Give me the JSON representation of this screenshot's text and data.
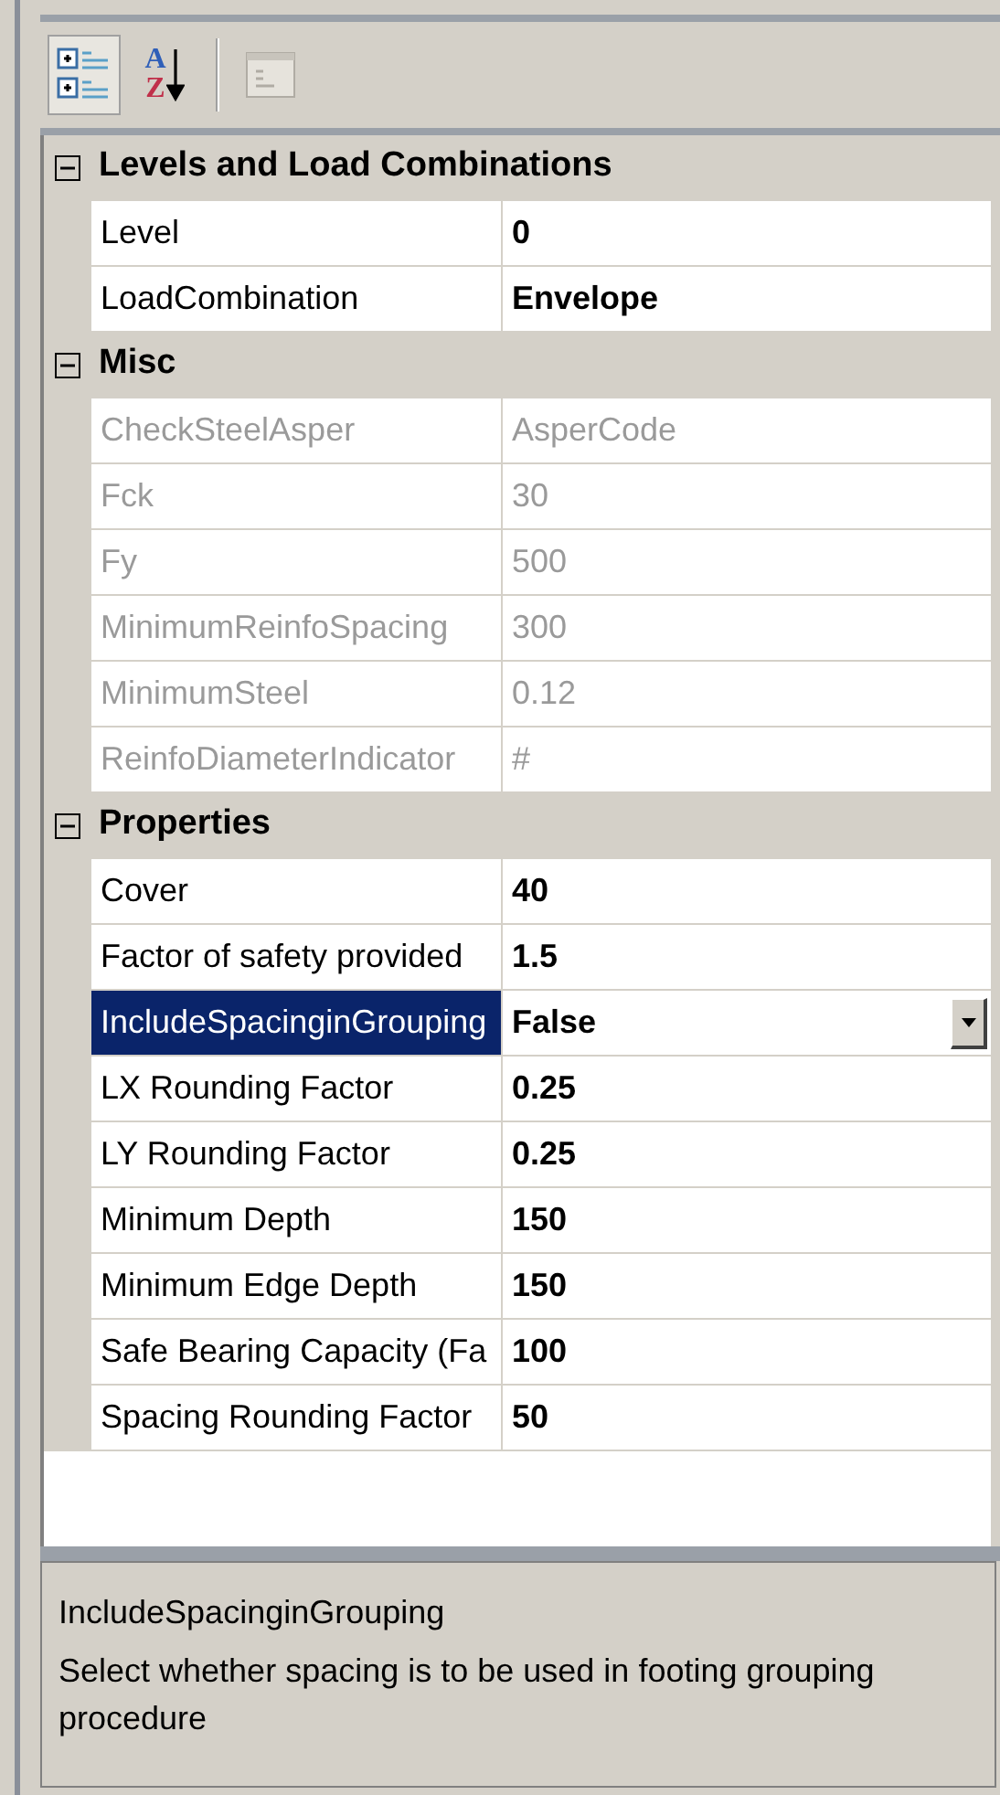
{
  "toolbar": [
    {
      "kind": "categorized",
      "selected": true
    },
    {
      "kind": "alphabetical",
      "selected": false,
      "glyphs": [
        "A",
        "Z"
      ]
    },
    {
      "kind": "pages",
      "selected": false,
      "disabled": true
    }
  ],
  "categories": [
    {
      "title": "Levels and Load Combinations",
      "expanded": true,
      "rows": [
        {
          "name": "Level",
          "value": "0",
          "disabled": false,
          "selected": false
        },
        {
          "name": "LoadCombination",
          "value": "Envelope",
          "disabled": false,
          "selected": false
        }
      ]
    },
    {
      "title": "Misc",
      "expanded": true,
      "rows": [
        {
          "name": "CheckSteelAsper",
          "value": "AsperCode",
          "disabled": true,
          "selected": false
        },
        {
          "name": "Fck",
          "value": "30",
          "disabled": true,
          "selected": false
        },
        {
          "name": "Fy",
          "value": "500",
          "disabled": true,
          "selected": false
        },
        {
          "name": "MinimumReinfoSpacing",
          "value": "300",
          "disabled": true,
          "selected": false
        },
        {
          "name": "MinimumSteel",
          "value": "0.12",
          "disabled": true,
          "selected": false
        },
        {
          "name": "ReinfoDiameterIndicator",
          "value": "#",
          "disabled": true,
          "selected": false
        }
      ]
    },
    {
      "title": "Properties",
      "expanded": true,
      "rows": [
        {
          "name": "Cover",
          "value": "40",
          "disabled": false,
          "selected": false
        },
        {
          "name": "Factor of safety provided",
          "value": "1.5",
          "disabled": false,
          "selected": false
        },
        {
          "name": "IncludeSpacinginGrouping",
          "value": "False",
          "disabled": false,
          "selected": true
        },
        {
          "name": "LX Rounding Factor",
          "value": "0.25",
          "disabled": false,
          "selected": false
        },
        {
          "name": "LY Rounding Factor",
          "value": "0.25",
          "disabled": false,
          "selected": false
        },
        {
          "name": "Minimum Depth",
          "value": "150",
          "disabled": false,
          "selected": false
        },
        {
          "name": "Minimum Edge Depth",
          "value": "150",
          "disabled": false,
          "selected": false
        },
        {
          "name": "Safe Bearing Capacity (Fa",
          "value": "100",
          "disabled": false,
          "selected": false
        },
        {
          "name": "Spacing Rounding Factor",
          "value": "50",
          "disabled": false,
          "selected": false
        }
      ]
    }
  ],
  "description": {
    "title": "IncludeSpacinginGrouping",
    "text": "Select whether spacing is to be used in footing grouping procedure"
  }
}
